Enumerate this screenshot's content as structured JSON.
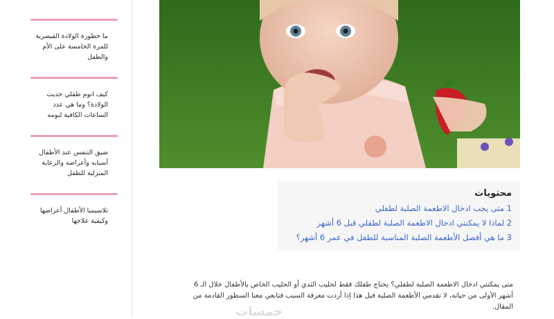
{
  "sidebar": {
    "items": [
      {
        "label": "ما خطورة الولادة القيصرية للمرة الخامسة على الأم والطفل"
      },
      {
        "label": "كيف انوم طفلي حديث الولادة؟ وما هي عدد الساعات الكافية لنومه"
      },
      {
        "label": "ضيق التنفس عند الأطفال أسبابه وأعراضه والرعاية المنزلية للطفل"
      },
      {
        "label": "ثلاسيميا الأطفال أعراضها وكيفية علاجها"
      }
    ]
  },
  "toc": {
    "title": "محتويات",
    "items": [
      {
        "label": "1 متى يجب ادخال الاطعمة الصلبة لطفلي"
      },
      {
        "label": "2 لماذا لا يمكنني ادخال الاطعمة الصلبة لطفلي قبل 6 أشهر"
      },
      {
        "label": "3 ما هي أفضل الأطعمة الصلبة المناسبة للطفل في عمر 6 أشهر؟"
      }
    ]
  },
  "article": {
    "paragraph": "متى يمكنني ادخال الاطعمة الصلبة لطفلي؟ يحتاج طفلك فقط لحليب الثدي أو الحليب الخاص بالأطفال خلال الـ 6 أشهر الأولى من حياته، لا تقدمي الأطعمة الصلبة قبل هذا إذا أردت معرفة السبب فتابعي معنا السطور القادمة من المقال."
  },
  "watermark": "خمسات",
  "colors": {
    "accent": "#e8a1b2",
    "link": "#3a66c4"
  }
}
